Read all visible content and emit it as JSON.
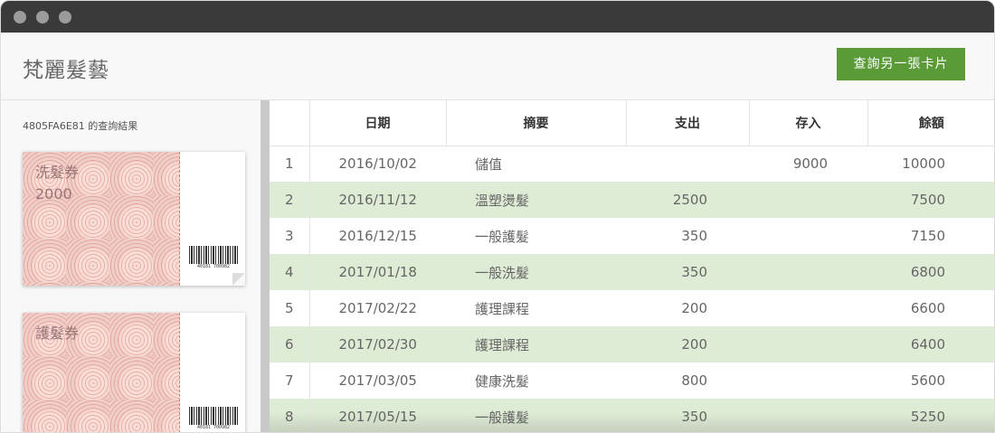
{
  "app": {
    "title": "梵麗髮藝",
    "query_button": "查詢另一張卡片"
  },
  "sidebar": {
    "caption": "4805FA6E81 的查詢結果",
    "vouchers": [
      {
        "title": "洗髮券",
        "amount": "2000",
        "barcode": "40181 700982"
      },
      {
        "title": "護髮券",
        "amount": "",
        "barcode": "40181 700982"
      }
    ]
  },
  "table": {
    "headers": [
      "",
      "日期",
      "摘要",
      "支出",
      "存入",
      "餘額"
    ],
    "rows": [
      {
        "no": "1",
        "date": "2016/10/02",
        "desc": "儲值",
        "out": "",
        "in": "9000",
        "bal": "10000"
      },
      {
        "no": "2",
        "date": "2016/11/12",
        "desc": "溫塑燙髮",
        "out": "2500",
        "in": "",
        "bal": "7500"
      },
      {
        "no": "3",
        "date": "2016/12/15",
        "desc": "一般護髮",
        "out": "350",
        "in": "",
        "bal": "7150"
      },
      {
        "no": "4",
        "date": "2017/01/18",
        "desc": "一般洗髮",
        "out": "350",
        "in": "",
        "bal": "6800"
      },
      {
        "no": "5",
        "date": "2017/02/22",
        "desc": "護理課程",
        "out": "200",
        "in": "",
        "bal": "6600"
      },
      {
        "no": "6",
        "date": "2017/02/30",
        "desc": "護理課程",
        "out": "200",
        "in": "",
        "bal": "6400"
      },
      {
        "no": "7",
        "date": "2017/03/05",
        "desc": "健康洗髮",
        "out": "800",
        "in": "",
        "bal": "5600"
      },
      {
        "no": "8",
        "date": "2017/05/15",
        "desc": "一般護髮",
        "out": "350",
        "in": "",
        "bal": "5250"
      }
    ]
  },
  "colors": {
    "accent": "#5a9a37",
    "row_stripe": "#deebd5",
    "titlebar": "#3a3a3a"
  }
}
